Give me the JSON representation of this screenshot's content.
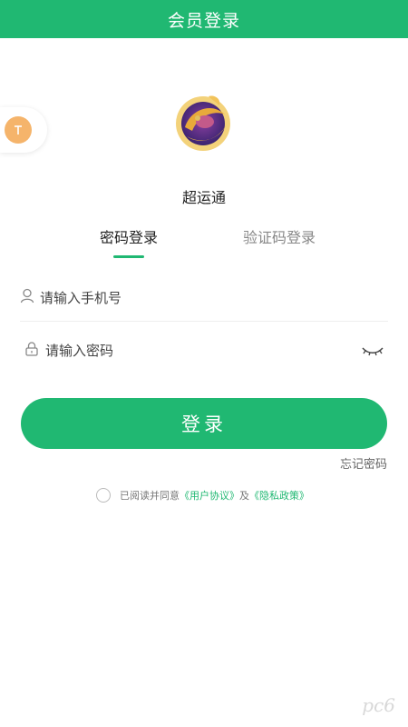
{
  "header": {
    "title": "会员登录"
  },
  "app": {
    "name": "超运通"
  },
  "tabs": [
    {
      "label": "密码登录",
      "active": true
    },
    {
      "label": "验证码登录",
      "active": false
    }
  ],
  "form": {
    "phone_placeholder": "请输入手机号",
    "password_placeholder": "请输入密码",
    "login_label": "登录",
    "forgot_label": "忘记密码"
  },
  "agreement": {
    "prefix": "已阅读并同意",
    "user_agreement": "《用户协议》",
    "and": "及",
    "privacy_policy": "《隐私政策》"
  },
  "float_button": {
    "icon": "arrow-up-icon"
  },
  "watermark": {
    "text": "pc6"
  },
  "colors": {
    "primary": "#20b872",
    "float_accent": "#f5b46b"
  }
}
